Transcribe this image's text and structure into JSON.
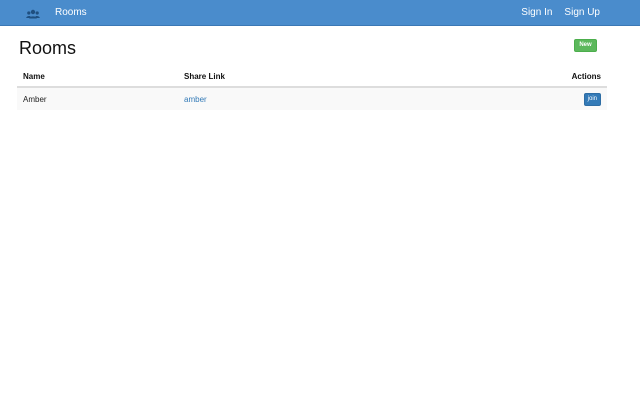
{
  "navbar": {
    "brand_icon": "users-icon",
    "brand_label": "Rooms",
    "sign_in_label": "Sign In",
    "sign_up_label": "Sign Up",
    "bg_color": "#4a8ccc"
  },
  "main": {
    "title": "Rooms",
    "new_button_label": "New",
    "table": {
      "headers": {
        "name": "Name",
        "share_link": "Share Link",
        "actions": "Actions"
      },
      "rows": [
        {
          "name": "Amber",
          "share_link": "amber",
          "action_label": "join"
        }
      ]
    }
  },
  "colors": {
    "new_button": "#5cb85c",
    "join_button": "#337ab7",
    "link": "#337ab7"
  }
}
